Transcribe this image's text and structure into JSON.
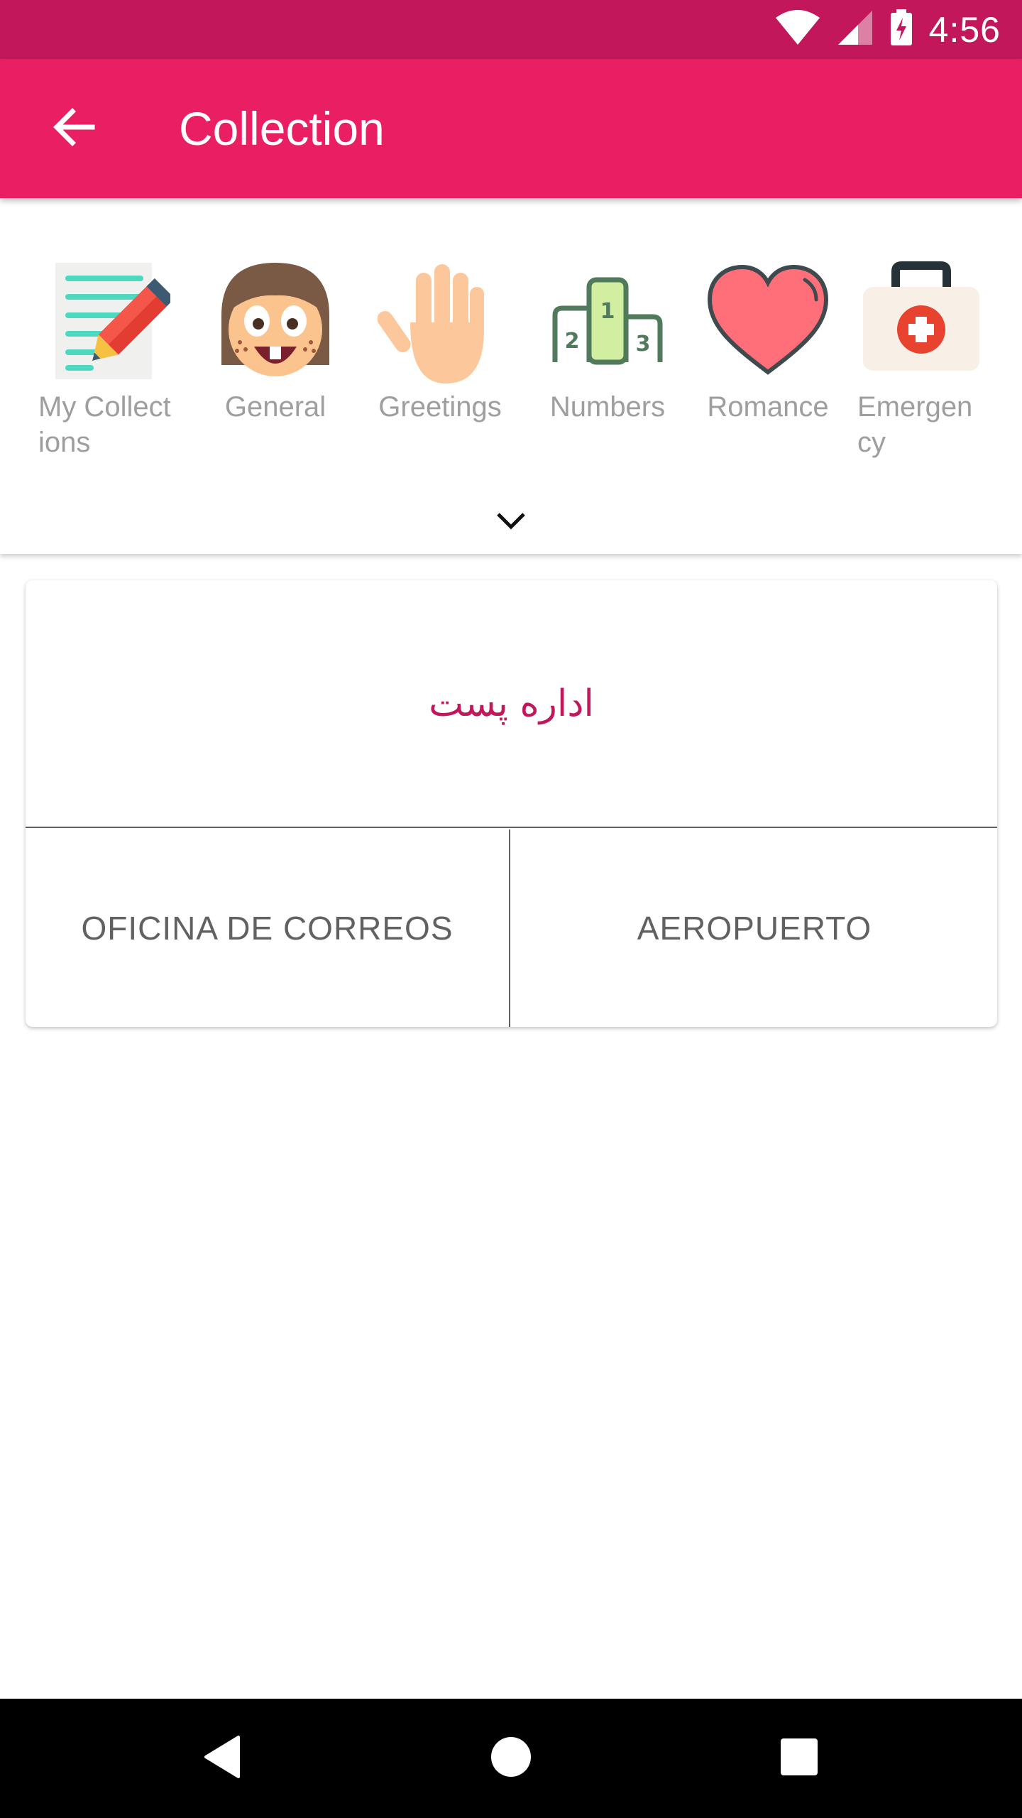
{
  "status_bar": {
    "time": "4:56",
    "icons": [
      "wifi-icon",
      "signal-icon",
      "battery-charging-icon"
    ]
  },
  "app_bar": {
    "title": "Collection",
    "back_icon": "arrow-back-icon"
  },
  "categories": [
    {
      "label": "My Collect\nions",
      "icon": "notepad-pencil-icon"
    },
    {
      "label": "General",
      "icon": "smiling-face-icon"
    },
    {
      "label": "Greetings",
      "icon": "raised-hand-icon"
    },
    {
      "label": "Numbers",
      "icon": "podium-icon"
    },
    {
      "label": "Romance",
      "icon": "heart-icon"
    },
    {
      "label": "Emergen\ncy",
      "icon": "first-aid-kit-icon"
    }
  ],
  "expand_icon": "chevron-down-icon",
  "quiz": {
    "question": "اداره پست",
    "options": [
      "OFICINA DE CORREOS",
      "AEROPUERTO"
    ]
  },
  "colors": {
    "status_bar": "#c2185b",
    "app_bar": "#e91e63",
    "question_text": "#c2185b",
    "label_gray": "#9e9e9e"
  }
}
